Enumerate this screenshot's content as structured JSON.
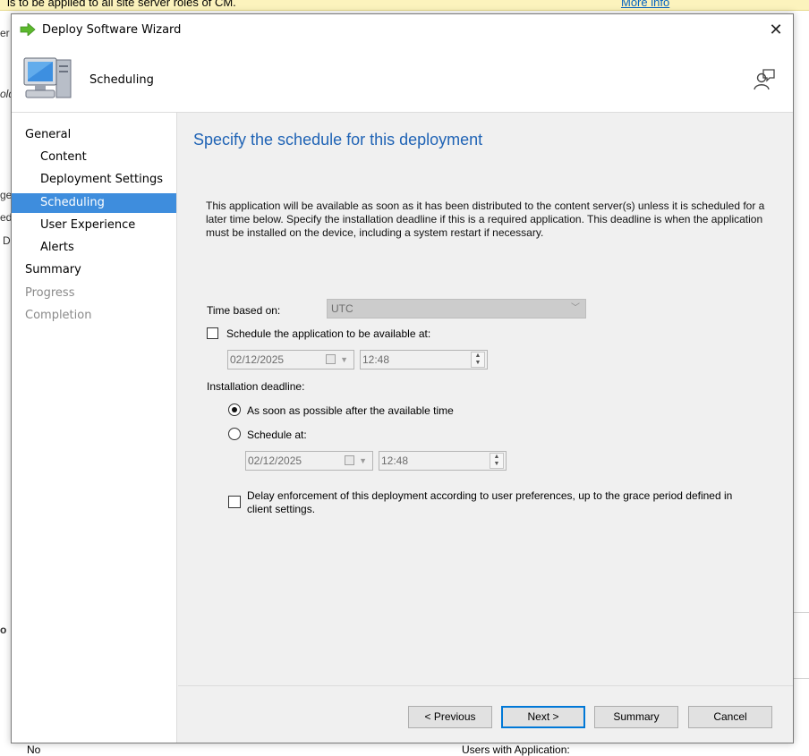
{
  "background": {
    "banner_text": "is to be applied to all site server roles of CM.",
    "banner_link": "More info",
    "fragments": [
      "er",
      "old",
      "ge",
      "ed",
      "D",
      "o"
    ],
    "bottom_left": "No",
    "bottom_right": "Users with Application:"
  },
  "dialog": {
    "title": "Deploy Software Wizard",
    "header_page": "Scheduling",
    "icons": {
      "app": "green-arrow-icon",
      "header": "computer-icon",
      "help": "user-help-icon",
      "close": "close-icon"
    }
  },
  "nav": {
    "items": [
      {
        "label": "General",
        "state": "normal"
      },
      {
        "label": "Content",
        "state": "normal"
      },
      {
        "label": "Deployment Settings",
        "state": "normal"
      },
      {
        "label": "Scheduling",
        "state": "active"
      },
      {
        "label": "User Experience",
        "state": "normal"
      },
      {
        "label": "Alerts",
        "state": "normal"
      },
      {
        "label": "Summary",
        "state": "normal"
      },
      {
        "label": "Progress",
        "state": "disabled"
      },
      {
        "label": "Completion",
        "state": "disabled"
      }
    ]
  },
  "content": {
    "heading": "Specify the schedule for this deployment",
    "description": "This application will be available as soon as it has been distributed to the content server(s) unless it is scheduled for a later time below. Specify the installation deadline if this is a required application. This deadline is when the application must be installed on the device, including a system restart if necessary.",
    "time_based_on_label": "Time based on:",
    "time_based_on_value": "UTC",
    "schedule_available_label": "Schedule the application to be available at:",
    "schedule_available_checked": false,
    "available_date": "02/12/2025",
    "available_time": "12:48",
    "deadline_label": "Installation deadline:",
    "asap_label": "As soon as possible after the available time",
    "asap_selected": true,
    "schedule_at_label": "Schedule at:",
    "schedule_at_selected": false,
    "deadline_date": "02/12/2025",
    "deadline_time": "12:48",
    "delay_label": "Delay enforcement of this deployment according to user preferences, up to the grace period defined in client settings.",
    "delay_checked": false
  },
  "buttons": {
    "previous": "< Previous",
    "next": "Next >",
    "summary": "Summary",
    "cancel": "Cancel"
  },
  "colors": {
    "accent": "#3e8ddd",
    "heading": "#1f63b5",
    "banner": "#fcf3bd"
  }
}
